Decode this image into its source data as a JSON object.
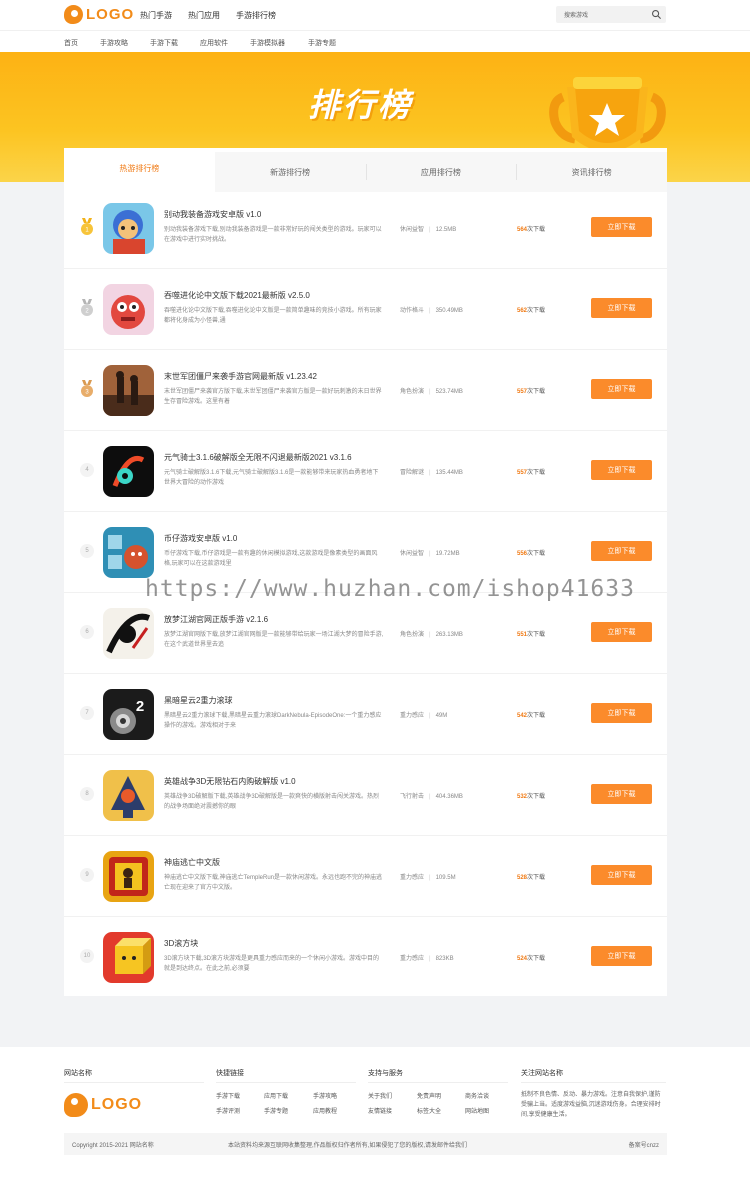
{
  "header": {
    "logo_text": "LOGO",
    "nav": [
      "热门手游",
      "热门应用",
      "手游排行榜"
    ],
    "search_placeholder": "搜索游戏"
  },
  "subnav": [
    "首页",
    "手游攻略",
    "手游下载",
    "应用软件",
    "手游模拟器",
    "手游专题"
  ],
  "banner": {
    "title": "排行榜"
  },
  "tabs": [
    "热游排行榜",
    "新游排行榜",
    "应用排行榜",
    "资讯排行榜"
  ],
  "download_label": "立即下载",
  "count_suffix": "次下载",
  "games": [
    {
      "rank": "1",
      "name": "别动我装备游戏安卓版 v1.0",
      "desc": "别动我装备游戏下载,别动我装备游戏是一款非常好玩的闯关类型的游戏。玩家可以在游戏中进行实时挑战。",
      "category": "休闲益智",
      "size": "12.5MB",
      "count": "564"
    },
    {
      "rank": "2",
      "name": "吞噬进化论中文版下载2021最新版 v2.5.0",
      "desc": "吞噬进化论中文版下载,吞噬进化论中文版是一款简单趣味的竞技小游戏。所有玩家都将化身成为小怪兽,通",
      "category": "动作格斗",
      "size": "350.49MB",
      "count": "562"
    },
    {
      "rank": "3",
      "name": "末世军团僵尸来袭手游官网最新版 v1.23.42",
      "desc": "末世军团僵尸来袭官方版下载,末世军团僵尸来袭官方版是一款好玩刺激的末日世界生存冒险游戏。这里有着",
      "category": "角色扮演",
      "size": "523.74MB",
      "count": "557"
    },
    {
      "rank": "4",
      "name": "元气骑士3.1.6破解版全无限不闪退最新版2021 v3.1.6",
      "desc": "元气骑士破解版3.1.6下载,元气骑士破解版3.1.6是一款能够带来玩家热血勇者地下世界大冒险的动作游戏",
      "category": "冒险解谜",
      "size": "135.44MB",
      "count": "557"
    },
    {
      "rank": "5",
      "name": "币仔游戏安卓版 v1.0",
      "desc": "币仔游戏下载,币仔游戏是一款有趣的休闲模拟游戏,这款游戏是像素类型的画面风格,玩家可以在这款游戏里",
      "category": "休闲益智",
      "size": "19.72MB",
      "count": "556"
    },
    {
      "rank": "6",
      "name": "放梦江湖官网正版手游 v2.1.6",
      "desc": "放梦江湖官网版下载,放梦江湖官网版是一款能够带给玩家一场江湖大梦的冒险手游,在这个武道世界里去追",
      "category": "角色扮演",
      "size": "263.13MB",
      "count": "551"
    },
    {
      "rank": "7",
      "name": "黑暗星云2重力滚球",
      "desc": "黑暗星云2重力滚球下载,黑暗星云重力滚球DarkNebula-EpisodeOne:一个重力感应操作的游戏。游戏相对于来",
      "category": "重力感应",
      "size": "49M",
      "count": "542"
    },
    {
      "rank": "8",
      "name": "英雄战争3D无限钻石内购破解版 v1.0",
      "desc": "英雄战争3D破解版下载,英雄战争3D破解版是一款爽快的横版射击闯关游戏。热烈的战争场面绝对震撼你的眼",
      "category": "飞行射击",
      "size": "404.36MB",
      "count": "532"
    },
    {
      "rank": "9",
      "name": "神庙逃亡中文版",
      "desc": "神庙逃亡中文版下载,神庙逃亡TempleRun是一款休闲游戏。永远也跑不完的神庙逃亡现在迎来了官方中文版。",
      "category": "重力感应",
      "size": "109.5M",
      "count": "528"
    },
    {
      "rank": "10",
      "name": "3D滚方块",
      "desc": "3D滚方块下载,3D滚方块游戏是更具重力感应而来的一个休闲小游戏。游戏中目的就是到达终点。在此之前,必须要",
      "category": "重力感应",
      "size": "823KB",
      "count": "524"
    }
  ],
  "watermark": "https://www.huzhan.com/ishop41633",
  "footer": {
    "col1_title": "网站名称",
    "col2_title": "快捷链接",
    "col2_links": [
      "手游下载",
      "应用下载",
      "手游攻略",
      "手游评测",
      "手游专题",
      "应用教程"
    ],
    "col3_title": "支持与服务",
    "col3_links": [
      "关于我们",
      "免责声明",
      "商务洽谈",
      "友情链接",
      "标签大全",
      "网站地图"
    ],
    "col4_title": "关注网站名称",
    "col4_text": "抵制不良色情、反动、暴力游戏。注意自我保护,谨防受骗上当。适度游戏益脑,沉迷游戏伤身。合理安排时间,享受健康生活。",
    "copyright": "Copyright 2015-2021 网站名称",
    "notice": "本站资料均来源互联网收集整理,作品版权归作者所有,如果侵犯了您的版权,请发邮件给我们",
    "icp": "备案号cnzz"
  },
  "colors": {
    "accent": "#f07a14",
    "button": "#fb8b2b",
    "banner": "#fdb214"
  }
}
